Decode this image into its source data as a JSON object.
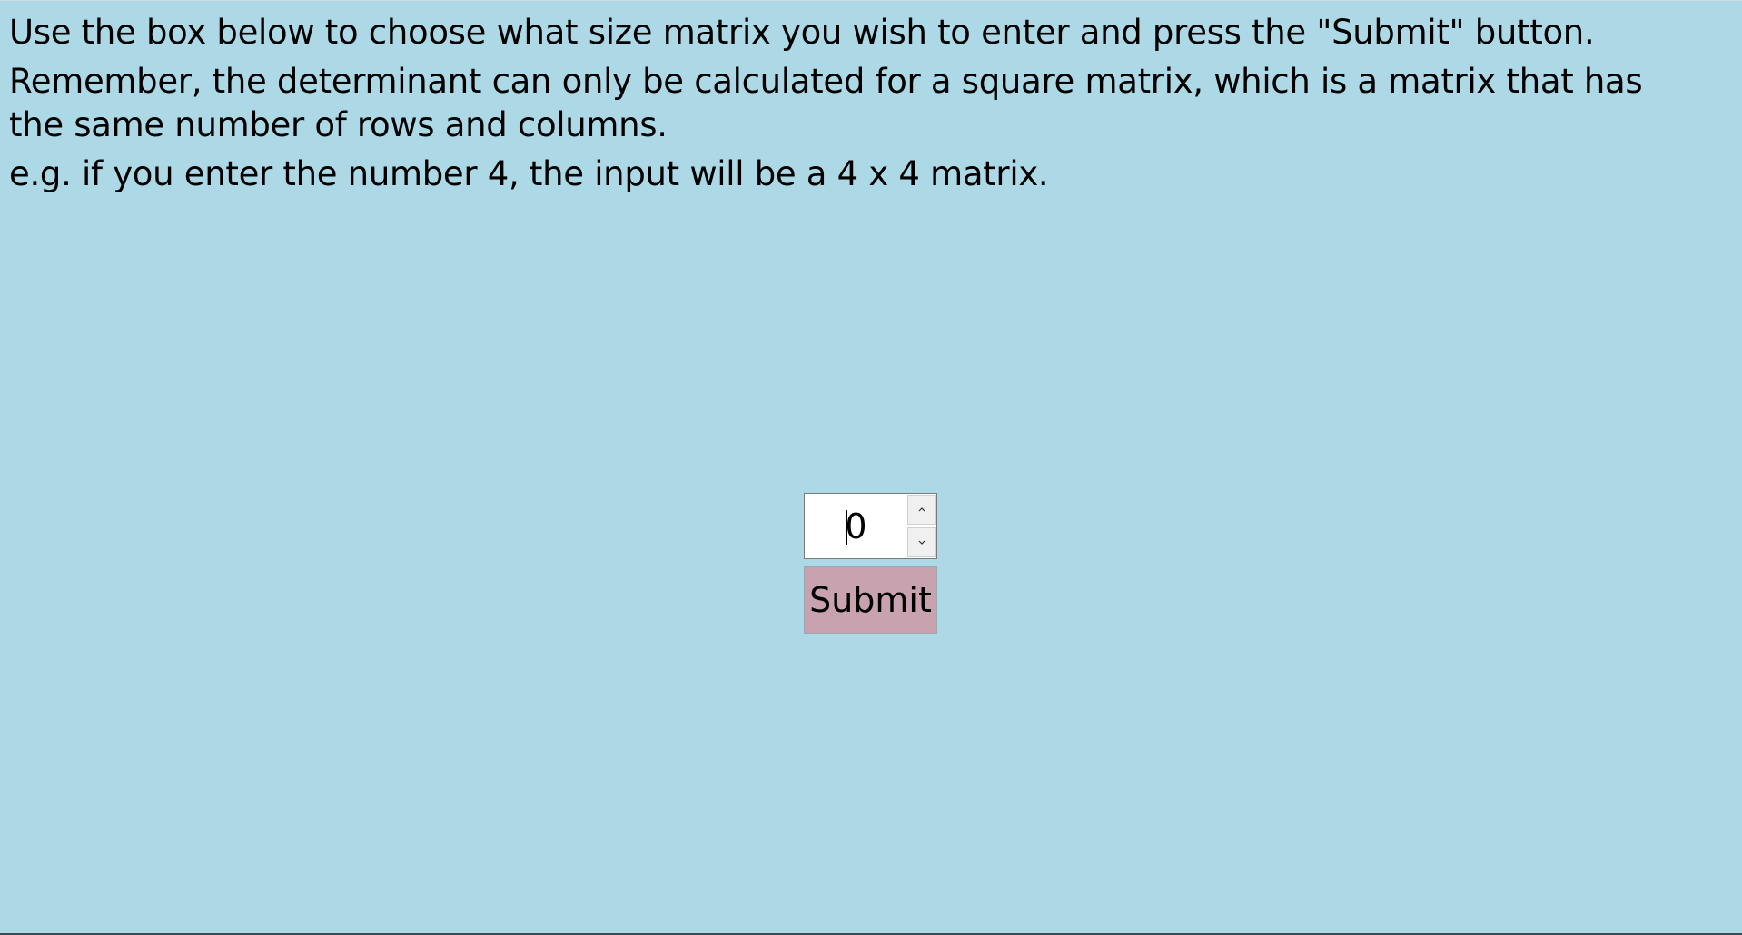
{
  "instructions": {
    "line1": "Use the box below to choose what size matrix you wish to enter and press the \"Submit\" button.",
    "line2": "Remember, the determinant can only be calculated for a square matrix, which is a matrix that has the same number of rows and columns.",
    "line3": "e.g. if you enter the number 4, the input will be a 4 x 4 matrix."
  },
  "matrix_size": {
    "value": "0",
    "up_icon": "chevron-up-icon",
    "down_icon": "chevron-down-icon"
  },
  "submit": {
    "label": "Submit",
    "color": "#c8a2ae"
  },
  "theme": {
    "background": "#add8e6"
  }
}
